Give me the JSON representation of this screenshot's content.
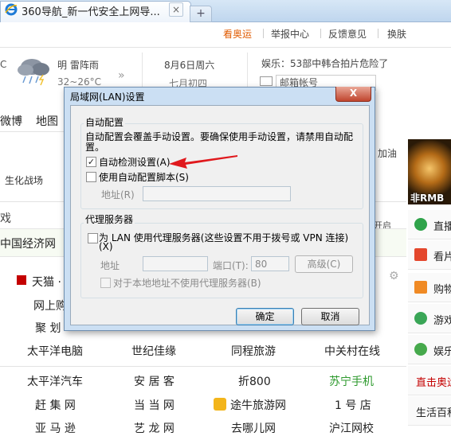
{
  "browser": {
    "tab_title": "360导航_新一代安全上网导...",
    "tab_close": "×",
    "new_tab": "+"
  },
  "top_links": [
    "看奥运",
    "举报中心",
    "反馈意见",
    "换肤"
  ],
  "weather": {
    "unit_fragment": "C",
    "description": "明 雷阵雨",
    "temperature": "32~26°C",
    "chevron": "»"
  },
  "date": {
    "solar": "8月6日周六",
    "lunar": "七月初四"
  },
  "news": {
    "headline": "娱乐：53部中韩合拍片危险了",
    "mail_placeholder": "邮箱帐号"
  },
  "left_nav": [
    "微博",
    "地图"
  ],
  "game_label": "生化战场",
  "jiare": "加油",
  "games_tab": "戏",
  "kaiqi": "开启",
  "cnet": "中国经济网",
  "ad_text": "非RMB",
  "sidebar": [
    "直播",
    "看片",
    "购物",
    "游戏",
    "娱乐",
    "直击奥运",
    "生活百科"
  ],
  "sites": {
    "row1": [
      "天猫 ·"
    ],
    "row2": [
      "网上购"
    ],
    "row3": [
      "聚 划"
    ],
    "row4": [
      "太平洋电脑",
      "世纪佳缘",
      "同程旅游",
      "中关村在线"
    ],
    "row5": [
      "太平洋汽车",
      "安 居 客",
      "折800",
      "苏宁手机"
    ],
    "row6": [
      "赶 集 网",
      "当 当 网",
      "途牛旅游网",
      "1 号 店"
    ],
    "row7": [
      "亚 马 逊",
      "艺 龙 网",
      "去哪儿网",
      "沪江网校"
    ]
  },
  "dialog": {
    "title": "局域网(LAN)设置",
    "close": "X",
    "auto_group": {
      "title": "自动配置",
      "description_line1": "自动配置会覆盖手动设置。要确保使用手动设置，请禁用自动配",
      "description_line2": "置。",
      "auto_detect_label": "自动检测设置(A)",
      "auto_detect_checked": true,
      "auto_script_label": "使用自动配置脚本(S)",
      "auto_script_checked": false,
      "address_label": "地址(R)",
      "address_value": ""
    },
    "proxy_group": {
      "title": "代理服务器",
      "use_proxy_line1": "为 LAN 使用代理服务器(这些设置不用于拨号或 VPN 连接)",
      "use_proxy_line2": "(X)",
      "use_proxy_checked": false,
      "address_label": "地址",
      "address_value": "",
      "port_label": "端口(T):",
      "port_value": "80",
      "advanced_label": "高级(C)",
      "bypass_label": "对于本地地址不使用代理服务器(B)",
      "bypass_checked": false
    },
    "ok_label": "确定",
    "cancel_label": "取消"
  },
  "colors": {
    "accent_orange": "#e05a00",
    "dialog_frame": "#cbdff3",
    "close_red": "#c0452e",
    "arrow_red": "#e0191d",
    "link_green": "#2e9a2e"
  }
}
